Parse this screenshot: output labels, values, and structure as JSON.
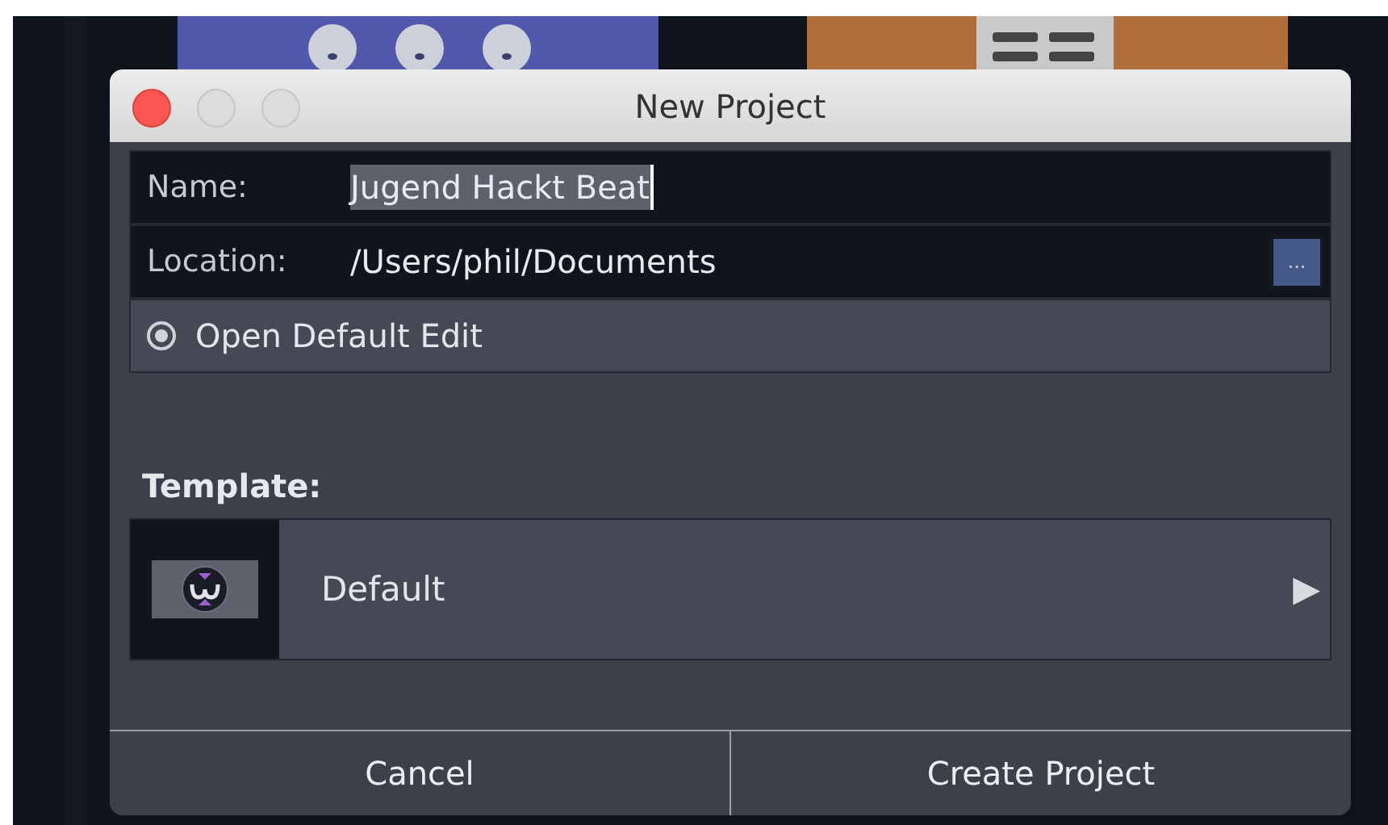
{
  "window": {
    "title": "New Project"
  },
  "fields": [
    {
      "label": "Name:",
      "value": "Jugend Hackt Beat",
      "focused": true
    },
    {
      "label": "Location:",
      "value": "/Users/phil/Documents",
      "browse": "..."
    }
  ],
  "option": {
    "label": "Open Default Edit",
    "selected": true
  },
  "template": {
    "heading": "Template:",
    "name": "Default",
    "arrow": "▶"
  },
  "buttons": [
    "Cancel",
    "Create Project"
  ]
}
